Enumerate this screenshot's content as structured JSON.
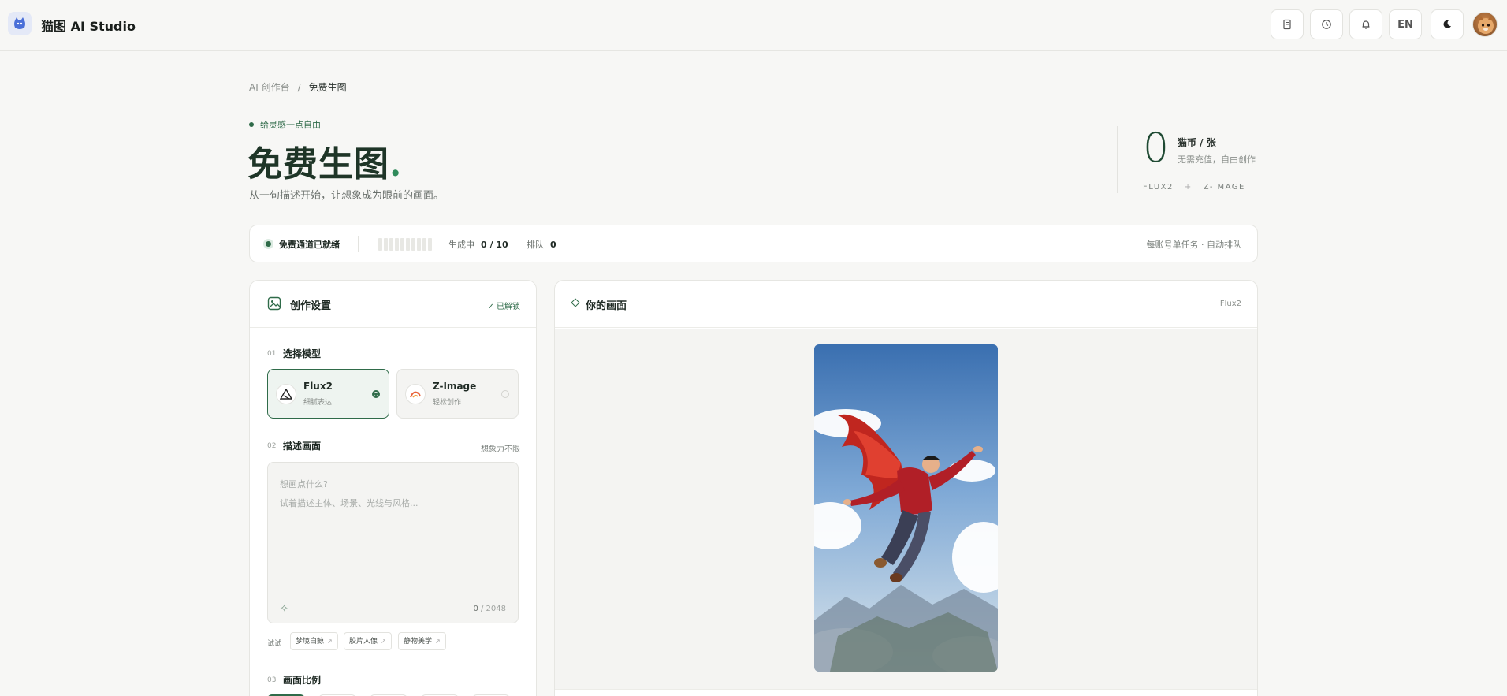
{
  "app": {
    "title": "猫图 AI Studio"
  },
  "header": {
    "lang_label": "EN"
  },
  "breadcrumb": {
    "root": "AI 创作台",
    "sep": "/",
    "current": "免费生图"
  },
  "hero": {
    "tag": "给灵感一点自由",
    "title": "免费生图",
    "title_dot": ".",
    "subtitle": "从一句描述开始，让想象成为眼前的画面。"
  },
  "price": {
    "amount": "0",
    "unit": "猫币 / 张",
    "note": "无需充值，自由创作",
    "model_a": "FLUX2",
    "plus": "+",
    "model_b": "Z-IMAGE"
  },
  "status": {
    "ready": "免费通道已就绪",
    "generating_label": "生成中",
    "generating_value": "0 / 10",
    "queue_label": "排队",
    "queue_value": "0",
    "right_note": "每账号单任务 · 自动排队"
  },
  "settings": {
    "title": "创作设置",
    "unlocked": "已解锁",
    "s1_num": "01",
    "s1_title": "选择模型",
    "models": [
      {
        "name": "Flux2",
        "desc": "细腻表达",
        "selected": true
      },
      {
        "name": "Z-Image",
        "desc": "轻松创作",
        "selected": false
      }
    ],
    "s2_num": "02",
    "s2_title": "描述画面",
    "s2_hint": "想象力不限",
    "prompt_value": "",
    "prompt_placeholder": "想画点什么?\n试着描述主体、场景、光线与风格...",
    "char_count": "0",
    "char_max": "/ 2048",
    "try_label": "试试",
    "chips": [
      "梦境白鲸",
      "胶片人像",
      "静物美学"
    ],
    "s3_num": "03",
    "s3_title": "画面比例"
  },
  "output": {
    "title": "你的画面",
    "model": "Flux2"
  },
  "colors": {
    "accent": "#2f6b49",
    "background": "#f7f7f5"
  }
}
